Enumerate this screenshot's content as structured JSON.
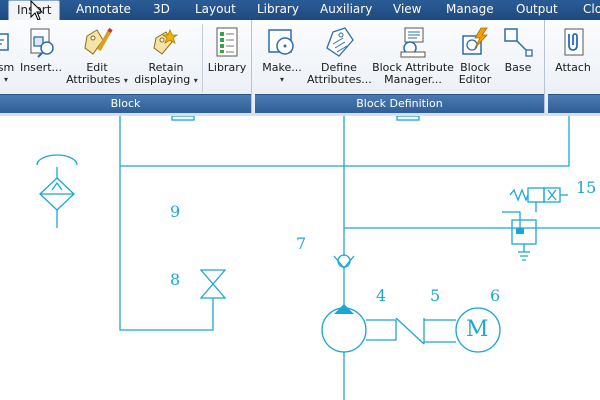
{
  "tabs": [
    {
      "label": "Insert",
      "active": true
    },
    {
      "label": "Annotate"
    },
    {
      "label": "3D"
    },
    {
      "label": "Layout"
    },
    {
      "label": "Library"
    },
    {
      "label": "Auxiliary"
    },
    {
      "label": "View"
    },
    {
      "label": "Manage"
    },
    {
      "label": "Output"
    },
    {
      "label": "Clo"
    }
  ],
  "ribbon": {
    "block_panel": {
      "title": "Block",
      "buttons": [
        {
          "line1": "sm",
          "line2": "",
          "icon": "mechanism-icon"
        },
        {
          "line1": "Insert...",
          "line2": "",
          "icon": "insert-block-icon"
        },
        {
          "line1": "Edit",
          "line2": "Attributes",
          "icon": "edit-attributes-icon"
        },
        {
          "line1": "Retain",
          "line2": "displaying",
          "icon": "retain-displaying-icon"
        },
        {
          "line1": "Library",
          "line2": "",
          "icon": "library-icon"
        }
      ]
    },
    "block_definition_panel": {
      "title": "Block Definition",
      "buttons": [
        {
          "line1": "Make...",
          "line2": "",
          "icon": "make-block-icon"
        },
        {
          "line1": "Define",
          "line2": "Attributes...",
          "icon": "define-attributes-icon"
        },
        {
          "line1": "Block Attribute",
          "line2": "Manager...",
          "icon": "block-attribute-manager-icon"
        },
        {
          "line1": "Block",
          "line2": "Editor",
          "icon": "block-editor-icon"
        },
        {
          "line1": "Base",
          "line2": "",
          "icon": "base-point-icon"
        }
      ]
    },
    "reference_panel": {
      "buttons": [
        {
          "line1": "Attach",
          "line2": "",
          "icon": "attach-icon"
        }
      ]
    }
  },
  "drawing": {
    "line_color": "#1aa7d6",
    "labels": {
      "l9": "9",
      "l8": "8",
      "l7": "7",
      "l4": "4",
      "l5": "5",
      "l6": "6",
      "l15": "15",
      "motor": "M"
    }
  }
}
